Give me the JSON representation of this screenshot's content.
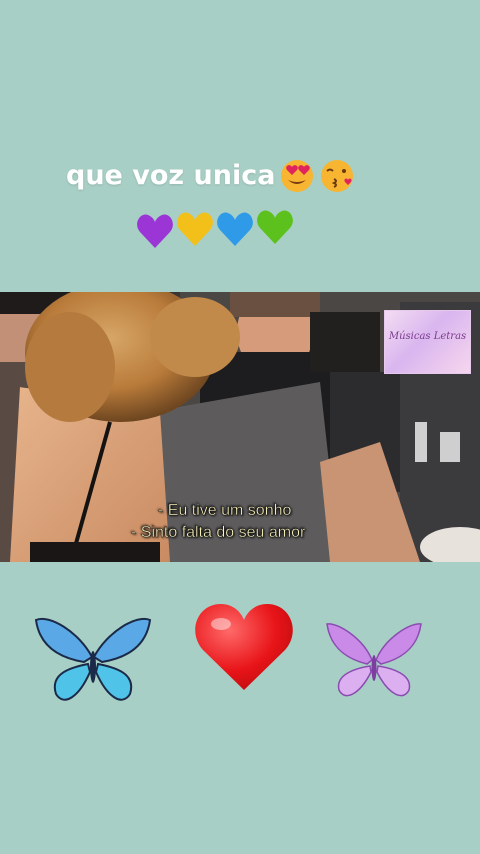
{
  "caption": {
    "text": "que voz unica",
    "emojis": [
      "heart-eyes-emoji",
      "kissing-emoji"
    ]
  },
  "hearts_row": [
    "purple-heart",
    "yellow-heart",
    "blue-heart",
    "green-heart"
  ],
  "video": {
    "watermark": "Músicas Letras",
    "subtitles": [
      "- Eu tive um sonho",
      "- Sinto falta do seu amor"
    ]
  },
  "decorations": [
    "blue-butterfly",
    "red-heart",
    "purple-butterfly"
  ],
  "colors": {
    "background": "#a8cfc5",
    "caption_text": "#ffffff",
    "subtitle_text": "#fff8c0"
  }
}
